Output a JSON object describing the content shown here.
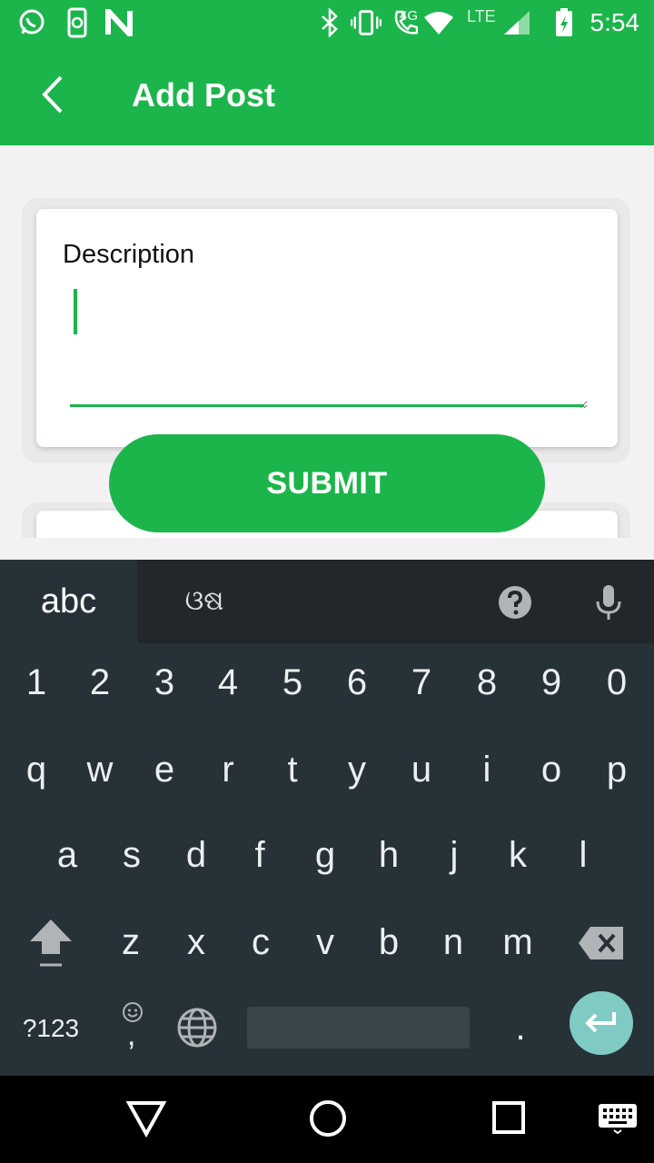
{
  "status_bar": {
    "time": "5:54",
    "network_label": "4G",
    "lte_label": "LTE",
    "left_icons": [
      "whatsapp-icon",
      "phone-sync-icon",
      "n-app-icon"
    ],
    "right_icons": [
      "bluetooth-icon",
      "vibrate-icon",
      "call-icon",
      "wifi-icon",
      "signal-icon",
      "battery-charging-icon"
    ]
  },
  "app_bar": {
    "title": "Add Post",
    "back_icon": "chevron-left-icon"
  },
  "form": {
    "description_label": "Description",
    "description_value": "",
    "submit_label": "SUBMIT"
  },
  "keyboard": {
    "tab_abc": "abc",
    "tab_odia": "ଓଷ",
    "number_row": [
      "1",
      "2",
      "3",
      "4",
      "5",
      "6",
      "7",
      "8",
      "9",
      "0"
    ],
    "row1": [
      "q",
      "w",
      "e",
      "r",
      "t",
      "y",
      "u",
      "i",
      "o",
      "p"
    ],
    "row2": [
      "a",
      "s",
      "d",
      "f",
      "g",
      "h",
      "j",
      "k",
      "l"
    ],
    "row3": [
      "z",
      "x",
      "c",
      "v",
      "b",
      "n",
      "m"
    ],
    "symbols_label": "?123",
    "comma_label": ",",
    "period_label": "."
  },
  "colors": {
    "brand_green": "#1bb54b",
    "keyboard_bg": "#263238",
    "enter_teal": "#7fcbc4"
  }
}
